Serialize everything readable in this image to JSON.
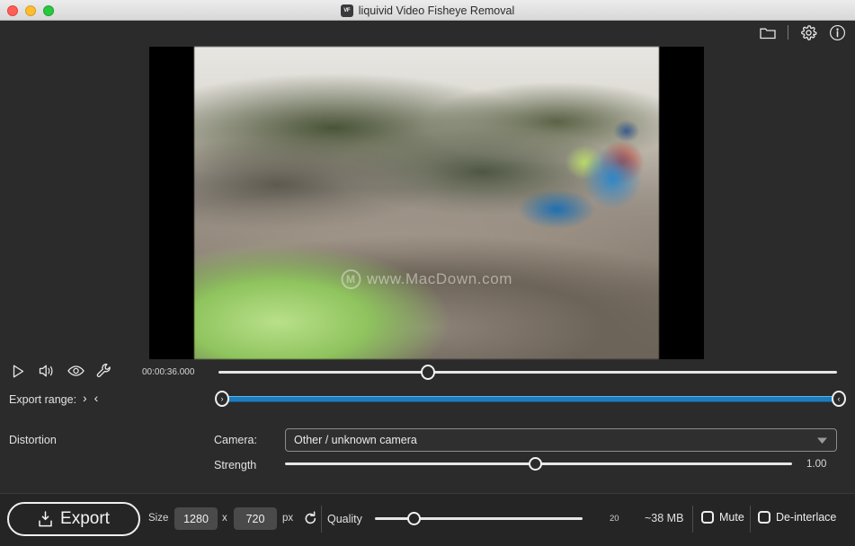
{
  "window": {
    "title": "liquivid Video Fisheye Removal",
    "app_icon_text": "VF",
    "traffic_lights": [
      "close",
      "minimize",
      "maximize"
    ]
  },
  "toolbar": {
    "icons": [
      {
        "name": "folder-icon",
        "label": "Open"
      },
      {
        "name": "divider",
        "label": "|"
      },
      {
        "name": "gear-icon",
        "label": "Settings"
      },
      {
        "name": "info-icon",
        "label": "Info"
      }
    ]
  },
  "preview": {
    "watermark_logo": "M",
    "watermark_text": "www.MacDown.com"
  },
  "player": {
    "icons": [
      {
        "name": "play-icon",
        "label": "Play"
      },
      {
        "name": "volume-icon",
        "label": "Volume"
      },
      {
        "name": "eye-icon",
        "label": "Preview toggle"
      },
      {
        "name": "wrench-icon",
        "label": "Tools"
      }
    ],
    "timecode": "00:00:36.000",
    "seek_position_percent": 33
  },
  "export_range": {
    "label": "Export range:",
    "arrow_in": "›",
    "arrow_out": "‹",
    "handle_left": "›",
    "handle_right": "‹",
    "range_start_percent": 0,
    "range_end_percent": 100,
    "bar_color": "#1e7cbd"
  },
  "distortion": {
    "section_label": "Distortion",
    "camera_label": "Camera:",
    "camera_value": "Other / unknown camera",
    "camera_options": [
      "Other / unknown camera"
    ],
    "dropdown_icon": "▼",
    "strength_label": "Strength",
    "strength_value": "1.00",
    "strength_position_percent": 48
  },
  "bottom": {
    "export_label": "Export",
    "export_icon": "export-box-icon",
    "size_label": "Size",
    "size_width": "1280",
    "size_x": "x",
    "size_height": "720",
    "size_unit": "px",
    "reset_icon": "reset-icon",
    "quality_label": "Quality",
    "quality_value": "20",
    "quality_position_percent": 16,
    "filesize": "~38 MB",
    "mute_label": "Mute",
    "mute_checked": false,
    "deinterlace_label": "De-interlace",
    "deinterlace_checked": false
  },
  "colors": {
    "background": "#2b2b2b",
    "bottom_bar": "#252525",
    "accent_blue": "#1e7cbd",
    "text": "#e2e2e2"
  }
}
